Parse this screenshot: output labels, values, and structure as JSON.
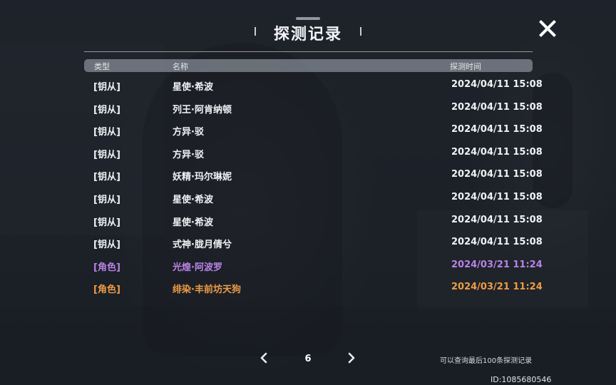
{
  "header": {
    "title": "探测记录"
  },
  "table": {
    "headers": {
      "type": "类型",
      "name": "名称",
      "time": "探测时间"
    },
    "rows": [
      {
        "type": "[钥从]",
        "name": "星使·希波",
        "time": "2024/04/11 15:08",
        "color": "#f0f2f5"
      },
      {
        "type": "[钥从]",
        "name": "列王·阿肯纳顿",
        "time": "2024/04/11 15:08",
        "color": "#f0f2f5"
      },
      {
        "type": "[钥从]",
        "name": "方异·驳",
        "time": "2024/04/11 15:08",
        "color": "#f0f2f5"
      },
      {
        "type": "[钥从]",
        "name": "方异·驳",
        "time": "2024/04/11 15:08",
        "color": "#f0f2f5"
      },
      {
        "type": "[钥从]",
        "name": "妖精·玛尔琳妮",
        "time": "2024/04/11 15:08",
        "color": "#f0f2f5"
      },
      {
        "type": "[钥从]",
        "name": "星使·希波",
        "time": "2024/04/11 15:08",
        "color": "#f0f2f5"
      },
      {
        "type": "[钥从]",
        "name": "星使·希波",
        "time": "2024/04/11 15:08",
        "color": "#f0f2f5"
      },
      {
        "type": "[钥从]",
        "name": "式神·胧月倩兮",
        "time": "2024/04/11 15:08",
        "color": "#f0f2f5"
      },
      {
        "type": "[角色]",
        "name": "光煌·阿波罗",
        "time": "2024/03/21 11:24",
        "color": "#b783e6"
      },
      {
        "type": "[角色]",
        "name": "绯染·丰前坊天狗",
        "time": "2024/03/21 11:24",
        "color": "#ee9c45"
      }
    ]
  },
  "pagination": {
    "current_page": "6",
    "prev_icon": "chevron-left-icon",
    "next_icon": "chevron-right-icon"
  },
  "footer": {
    "note": "可以查询最后100条探测记录",
    "uid": "ID:1085680546"
  },
  "icons": {
    "close": "close-icon"
  }
}
